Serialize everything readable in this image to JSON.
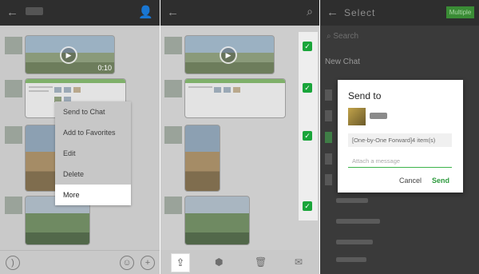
{
  "panel1": {
    "back_icon": "arrow-left-icon",
    "profile_icon": "person-icon",
    "video_duration": "0:10",
    "context_menu": {
      "items": [
        "Send to Chat",
        "Add to Favorites",
        "Edit",
        "Delete",
        "More"
      ],
      "selected": "More"
    },
    "bottom_icons": [
      "voice-icon",
      "emoji-icon",
      "plus-icon"
    ]
  },
  "panel2": {
    "back_icon": "arrow-left-icon",
    "search_icon": "search-icon",
    "checkbox_count": 4,
    "checkmark": "✓",
    "toolbar_icons": [
      "share-icon",
      "cube-icon",
      "trash-icon",
      "mail-icon"
    ]
  },
  "panel3": {
    "title": "Select",
    "multiple_label": "Multiple",
    "search_placeholder": "Search",
    "new_chat_label": "New Chat"
  },
  "dialog": {
    "title": "Send to",
    "forward_text": "[One-by-One Forward]4 item(s)",
    "attach_placeholder": "Attach a message",
    "cancel_label": "Cancel",
    "send_label": "Send",
    "accent_color": "#2c9a3c"
  }
}
